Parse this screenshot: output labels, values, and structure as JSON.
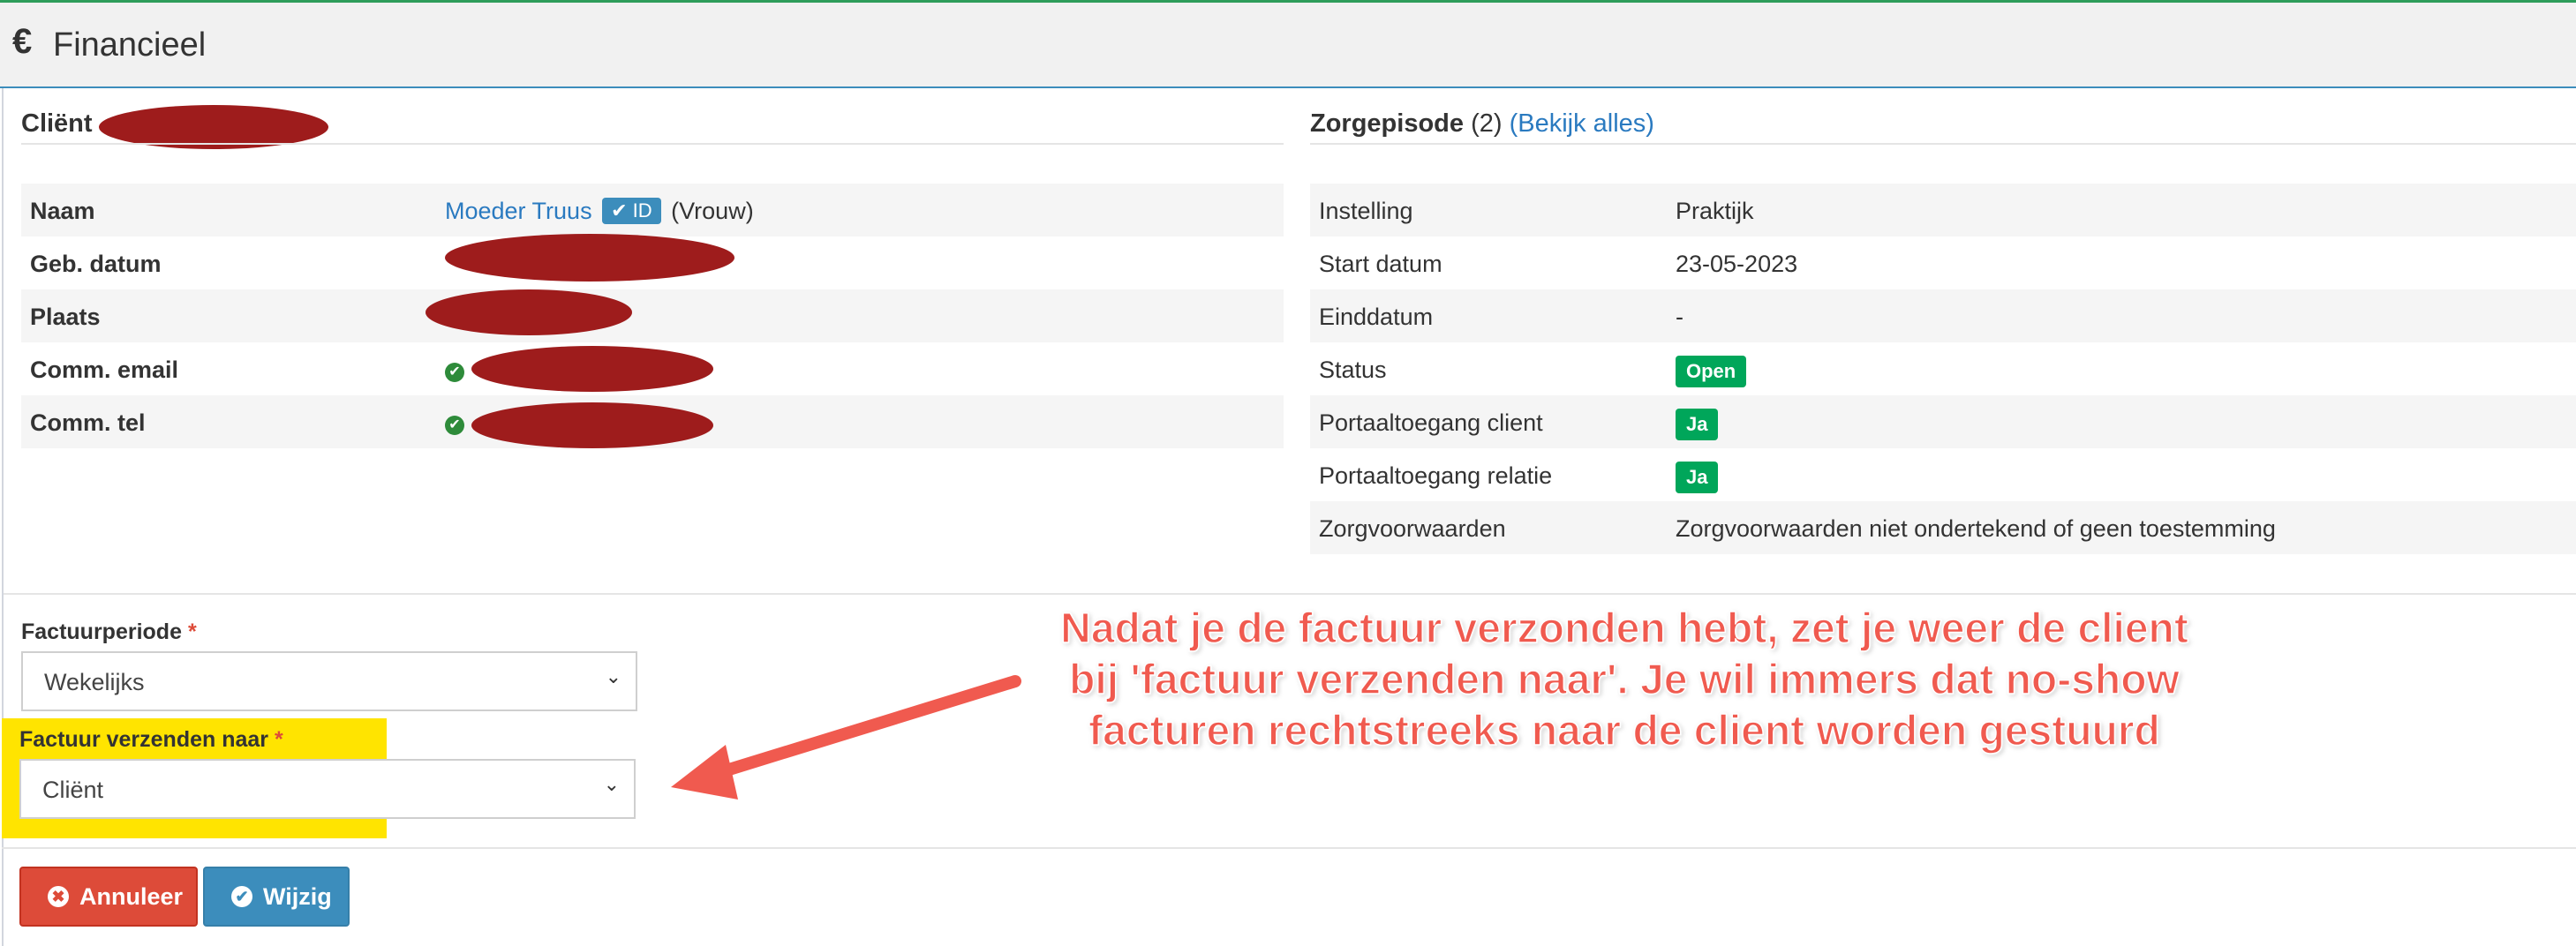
{
  "header": {
    "icon": "euro-icon",
    "title": "Financieel"
  },
  "client": {
    "title": "Cliënt",
    "rows": [
      {
        "label": "Naam",
        "value": "Moeder Truus",
        "badge": "ID",
        "suffix": "(Vrouw)"
      },
      {
        "label": "Geb. datum",
        "value": ""
      },
      {
        "label": "Plaats",
        "value": ""
      },
      {
        "label": "Comm. email",
        "value": ""
      },
      {
        "label": "Comm. tel",
        "value": ""
      }
    ]
  },
  "episode": {
    "title": "Zorgepisode",
    "count": "(2)",
    "link": "(Bekijk alles)",
    "rows": [
      {
        "label": "Instelling",
        "value": "Praktijk"
      },
      {
        "label": "Start datum",
        "value": "23-05-2023"
      },
      {
        "label": "Einddatum",
        "value": "-"
      },
      {
        "label": "Status",
        "value": "Open"
      },
      {
        "label": "Portaaltoegang client",
        "value": "Ja"
      },
      {
        "label": "Portaaltoegang relatie",
        "value": "Ja"
      },
      {
        "label": "Zorgvoorwaarden",
        "value": "Zorgvoorwaarden niet ondertekend of geen toestemming"
      }
    ]
  },
  "form": {
    "period_label": "Factuurperiode",
    "period_value": "Wekelijks",
    "send_label": "Factuur verzenden naar",
    "send_value": "Cliënt",
    "required_mark": "*"
  },
  "buttons": {
    "cancel": "Annuleer",
    "save": "Wijzig"
  },
  "annotation": {
    "lines": [
      "Nadat je de factuur verzonden hebt, zet je weer de client",
      "bij 'factuur verzenden naar'. Je wil immers dat no-show",
      "facturen rechtstreeks naar de client worden gestuurd"
    ],
    "color": "#f05a4f"
  },
  "colors": {
    "primary": "#3c8dbc",
    "danger": "#dd4b39",
    "success": "#00a65a",
    "highlight": "#ffe400"
  }
}
